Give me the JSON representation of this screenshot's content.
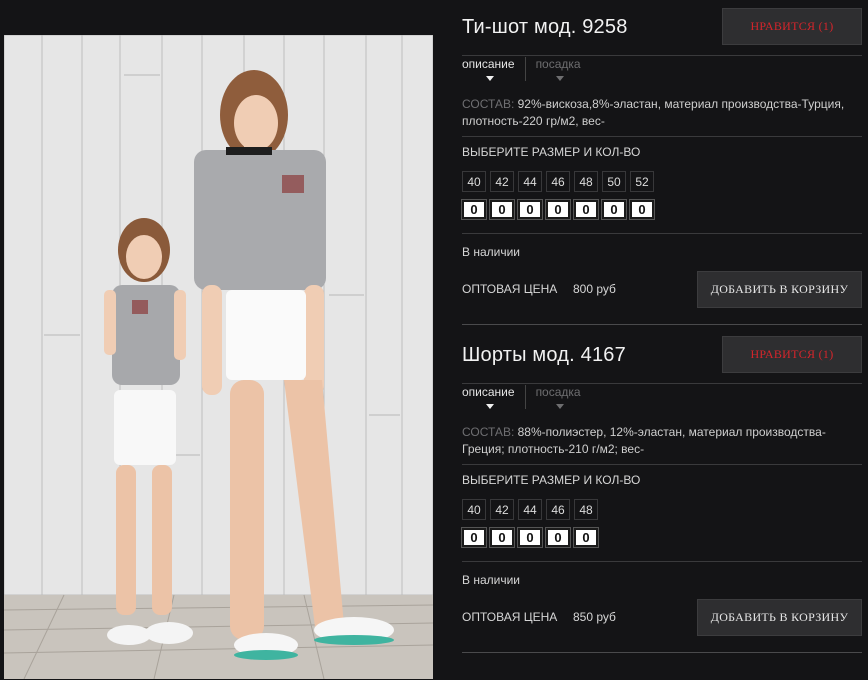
{
  "products": [
    {
      "title": "Ти-шот мод. 9258",
      "like_label": "НРАВИТСЯ (1)",
      "tabs": {
        "description": "описание",
        "fit": "посадка"
      },
      "composition_label": "СОСТАВ:",
      "composition_text": "92%-вискоза,8%-эластан, материал производства-Турция, плотность-220 гр/м2, вес-",
      "choose_label": "ВЫБЕРИТЕ РАЗМЕР И КОЛ-ВО",
      "sizes": [
        "40",
        "42",
        "44",
        "46",
        "48",
        "50",
        "52"
      ],
      "quantities": [
        "0",
        "0",
        "0",
        "0",
        "0",
        "0",
        "0"
      ],
      "stock": "В наличии",
      "price_label": "ОПТОВАЯ ЦЕНА",
      "price_value": "800 руб",
      "cart_label": "ДОБАВИТЬ В КОРЗИНУ"
    },
    {
      "title": "Шорты мод. 4167",
      "like_label": "НРАВИТСЯ (1)",
      "tabs": {
        "description": "описание",
        "fit": "посадка"
      },
      "composition_label": "СОСТАВ:",
      "composition_text": "88%-полиэстер, 12%-эластан, материал производства-Греция; плотность-210 г/м2; вес-",
      "choose_label": "ВЫБЕРИТЕ РАЗМЕР И КОЛ-ВО",
      "sizes": [
        "40",
        "42",
        "44",
        "46",
        "48"
      ],
      "quantities": [
        "0",
        "0",
        "0",
        "0",
        "0"
      ],
      "stock": "В наличии",
      "price_label": "ОПТОВАЯ ЦЕНА",
      "price_value": "850 руб",
      "cart_label": "ДОБАВИТЬ В КОРЗИНУ"
    }
  ],
  "colors": {
    "background": "#141416",
    "like_text": "#d5252b",
    "button_bg": "#2e2e30"
  }
}
